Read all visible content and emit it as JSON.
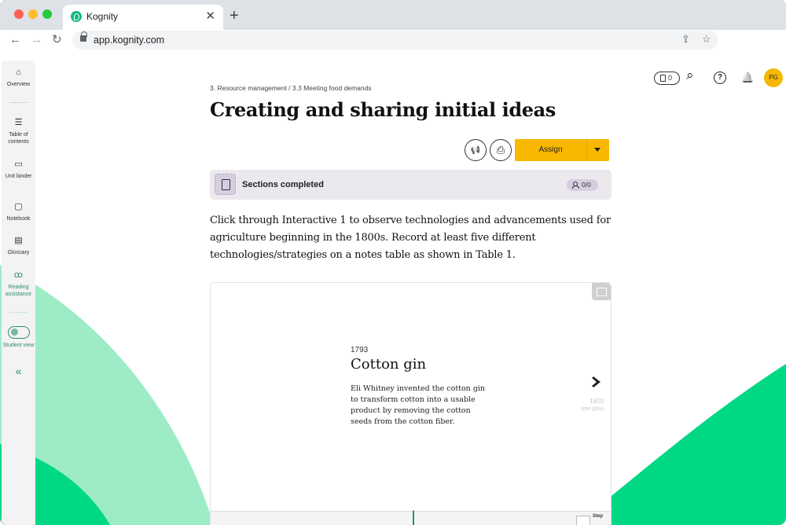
{
  "browser": {
    "tab_title": "Kognity",
    "tab_close": "✕",
    "new_tab": "+",
    "url": "app.kognity.com",
    "back": "←",
    "forward": "→",
    "reload": "↻",
    "share_icon": "⇪",
    "star_icon": "☆"
  },
  "sidebar": {
    "items": [
      {
        "label": "Overview",
        "icon": "⌂"
      },
      {
        "label": "Table of contents",
        "icon": "☰"
      },
      {
        "label": "Unit binder",
        "icon": "▭"
      },
      {
        "label": "Notebook",
        "icon": "▢"
      },
      {
        "label": "Glossary",
        "icon": "▤"
      },
      {
        "label": "Reading assistance",
        "icon": "ꝏ"
      },
      {
        "label": "Student view"
      }
    ],
    "collapse": "«"
  },
  "tools": {
    "assignments_count": "0",
    "search_icon": "⌕",
    "help_icon": "?",
    "bell_icon": "🔔",
    "avatar_initials": "PG"
  },
  "breadcrumb": "3. Resource management / 3.3 Meeting food demands",
  "title": "Creating and sharing initial ideas",
  "actions": {
    "announce_icon": "📢",
    "print_icon": "⎙",
    "assign_label": "Assign"
  },
  "sections": {
    "label": "Sections completed",
    "progress": "0/0"
  },
  "intro_text": "Click through Interactive 1 to observe technologies and advancements used for agriculture beginning in the 1800s. Record at least five different technologies/strategies on a notes table as shown in Table 1.",
  "interactive": {
    "year": "1793",
    "title": "Cotton gin",
    "description": "Eli Whitney invented the cotton gin to transform cotton into a usable product by removing the cotton seeds from the cotton fiber.",
    "next_year": "1800",
    "next_title": "Iron plow",
    "strip_label": "Step"
  },
  "colors": {
    "accent_green": "#00d884",
    "light_green": "#9eecc6",
    "assign_yellow": "#f8b800",
    "brand_teal": "#2a8f6b"
  }
}
